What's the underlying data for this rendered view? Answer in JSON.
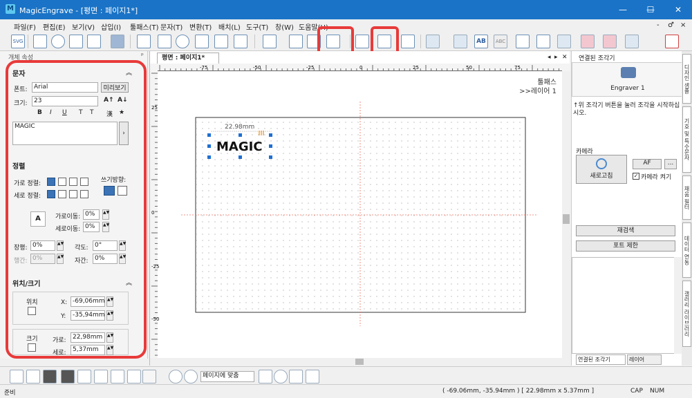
{
  "title": {
    "app_name": "MagicEngrave",
    "doc": "MagicEngrave - [평면 : 페이지1*]",
    "minimize": "—",
    "maximize": "☐",
    "close": "✕"
  },
  "menu": [
    "파일(F)",
    "편집(E)",
    "보기(V)",
    "삽입(I)",
    "툴패스(T)",
    "문자(T)",
    "변환(T)",
    "배치(L)",
    "도구(T)",
    "창(W)",
    "도움말(H)"
  ],
  "menu_right": [
    "-",
    "♂",
    "×"
  ],
  "toolbar": {
    "svg_label": "SVG",
    "ab_label": "AB",
    "abc_label": "ABC"
  },
  "left_panel": {
    "header": "개체 속성",
    "pin": "ᵖ",
    "text_section": "문자",
    "font_label": "폰트:",
    "font_value": "Arial",
    "preview_button": "미리보기",
    "size_label": "크기:",
    "size_value": "23",
    "style_buttons": [
      "B",
      "I",
      "U",
      "T",
      "T",
      "漢",
      "★"
    ],
    "text_value": "MAGIC",
    "align_section": "정렬",
    "h_align_label": "가로 정렬:",
    "v_align_label": "세로 정렬:",
    "write_dir_label": "쓰기방향:",
    "h_move_label": "가로이동:",
    "h_move_value": "0%",
    "v_move_label": "세로이동:",
    "v_move_value": "0%",
    "width_ratio_label": "장평:",
    "width_ratio_value": "0%",
    "angle_label": "각도:",
    "angle_value": "0°",
    "line_gap_label": "행간:",
    "line_gap_value": "0%",
    "char_gap_label": "자간:",
    "char_gap_value": "0%",
    "pos_section": "위치/크기",
    "position_label": "위치",
    "x_label": "X:",
    "x_value": "-69,06mm",
    "y_label": "Y:",
    "y_value": "-35,94mm",
    "size_group_label": "크기",
    "w_label": "가로:",
    "w_value": "22,98mm",
    "h_label": "세로:",
    "h_value": "5,37mm"
  },
  "doc": {
    "tab": "평면 : 페이지1*",
    "tab_nav": [
      "◂",
      "▸",
      "✕"
    ],
    "toolpath": "툴패스",
    "layer": ">>레이어 1",
    "ruler_h": [
      "-75",
      "-50",
      "-25",
      "0",
      "25",
      "50",
      "75"
    ],
    "ruler_v": [
      "25",
      "0",
      "-25",
      "-50"
    ],
    "text_object": "MAGIC",
    "dimension": "22.98mm"
  },
  "right_panel": {
    "header": "연결된 조각기",
    "engraver_name": "Engraver 1",
    "hint": "↑위 조각기 버튼을 눌러 조각을 시작하십시오.",
    "camera_section": "카메라",
    "refresh_button": "새로고침",
    "af_button": "AF",
    "more_button": "...",
    "camera_on_label": "카메라 켜기",
    "rescan_button": "재검색",
    "port_limit_button": "포트 제한",
    "tab_connected": "연결된 조각기",
    "tab_layer": "레이어"
  },
  "side_tabs": [
    "디자인 샘플",
    "기호 및 특수문자",
    "채움 필터",
    "데이터 연동",
    "갤러리 라이브러리"
  ],
  "bottom": {
    "zoom_fit": "페이지에 맞춤"
  },
  "status": {
    "left": "준비",
    "coords": "( -69.06mm, -35.94mm ) [ 22.98mm x 5.37mm ]",
    "cap": "CAP",
    "num": "NUM"
  },
  "colors": {
    "titlebar": "#1a73c6",
    "highlight": "#e83a3a",
    "selection": "#1f6fd1",
    "guide": "#f07060"
  }
}
